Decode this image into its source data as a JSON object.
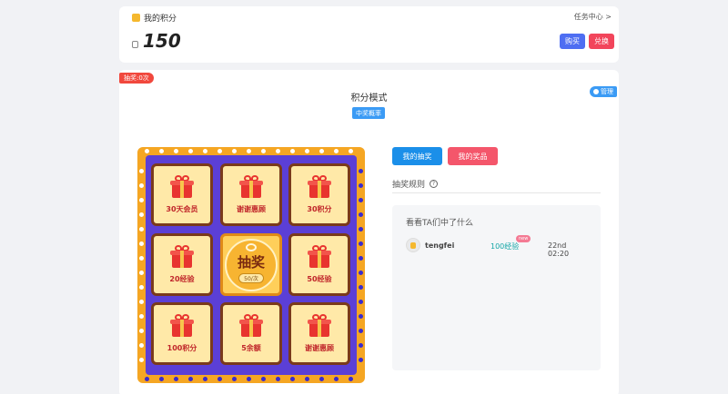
{
  "points": {
    "title": "我的积分",
    "task_link": "任务中心 >",
    "value": "150",
    "buy_label": "购买",
    "exchange_label": "兑换",
    "buy_color": "#4e6ef2",
    "exchange_color": "#f2455b"
  },
  "lottery": {
    "draw_count_tag": "抽奖:0次",
    "manage_label": "管理",
    "mode_title": "积分模式",
    "prob_label": "中奖概率",
    "center": {
      "label": "抽奖",
      "cost": "50/次"
    },
    "prizes": [
      "30天会员",
      "谢谢惠顾",
      "30积分",
      "20经验",
      "50经验",
      "100积分",
      "5余额",
      "谢谢惠顾"
    ],
    "board_color": "#f5a623",
    "inner_color": "#5b3fd6"
  },
  "side": {
    "tab_mine": "我的抽奖",
    "tab_prize": "我的奖品",
    "rules_label": "抽奖规则",
    "help_symbol": "?",
    "winners_title": "看看TA们中了什么",
    "winners": [
      {
        "name": "tengfei",
        "prize": "100经验",
        "badge": "new",
        "time": "22nd 02:20"
      }
    ]
  }
}
